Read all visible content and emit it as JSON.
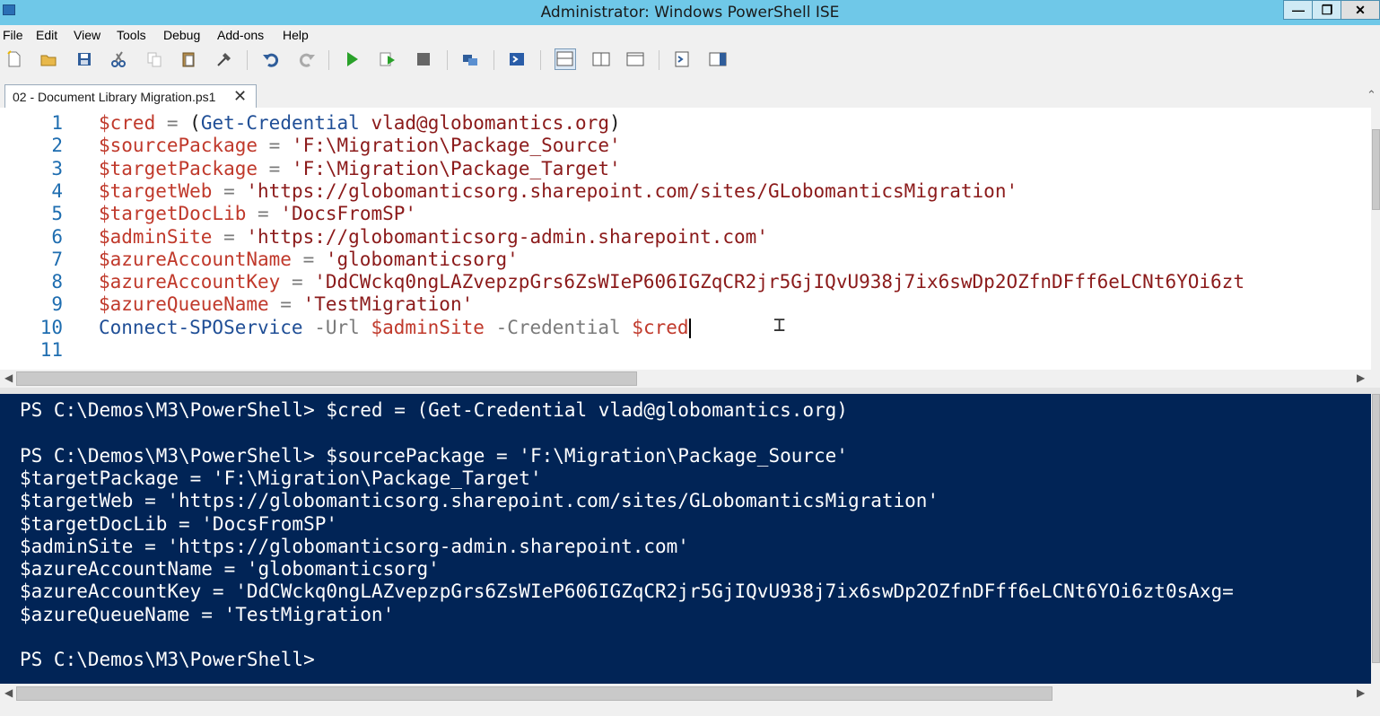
{
  "window": {
    "title": "Administrator: Windows PowerShell ISE",
    "minimize": "—",
    "restore": "❐",
    "close": "✕"
  },
  "menu": [
    "File",
    "Edit",
    "View",
    "Tools",
    "Debug",
    "Add-ons",
    "Help"
  ],
  "toolbar": [
    "new-icon",
    "open-icon",
    "save-icon",
    "cut-icon",
    "copy-icon",
    "paste-icon",
    "clear-icon",
    "undo-icon",
    "redo-icon",
    "run-icon",
    "run-selection-icon",
    "stop-icon",
    "remote-powershell-icon",
    "start-powershell-icon",
    "show-script-top-icon",
    "show-script-right-icon",
    "show-script-max-icon",
    "show-commands-icon",
    "show-command-addon-icon"
  ],
  "tab": {
    "label": "02 - Document Library Migration.ps1",
    "close": "✕"
  },
  "editor": {
    "line_numbers": [
      "1",
      "2",
      "3",
      "4",
      "5",
      "6",
      "7",
      "8",
      "9",
      "10",
      "11"
    ],
    "lines": [
      [
        [
          "v",
          "$cred"
        ],
        [
          "o",
          " = "
        ],
        [
          "p",
          "("
        ],
        [
          "c",
          "Get-Credential"
        ],
        [
          "p",
          " "
        ],
        [
          "s",
          "vlad@globomantics.org"
        ],
        [
          "p",
          ")"
        ]
      ],
      [
        [
          "v",
          "$sourcePackage"
        ],
        [
          "o",
          " = "
        ],
        [
          "s",
          "'F:\\Migration\\Package_Source'"
        ]
      ],
      [
        [
          "v",
          "$targetPackage"
        ],
        [
          "o",
          " = "
        ],
        [
          "s",
          "'F:\\Migration\\Package_Target'"
        ]
      ],
      [
        [
          "v",
          "$targetWeb"
        ],
        [
          "o",
          " = "
        ],
        [
          "s",
          "'https://globomanticsorg.sharepoint.com/sites/GLobomanticsMigration'"
        ]
      ],
      [
        [
          "v",
          "$targetDocLib"
        ],
        [
          "o",
          " = "
        ],
        [
          "s",
          "'DocsFromSP'"
        ]
      ],
      [
        [
          "v",
          "$adminSite"
        ],
        [
          "o",
          " = "
        ],
        [
          "s",
          "'https://globomanticsorg-admin.sharepoint.com'"
        ]
      ],
      [
        [
          "v",
          "$azureAccountName"
        ],
        [
          "o",
          " = "
        ],
        [
          "s",
          "'globomanticsorg'"
        ]
      ],
      [
        [
          "v",
          "$azureAccountKey"
        ],
        [
          "o",
          " = "
        ],
        [
          "s",
          "'DdCWckq0ngLAZvepzpGrs6ZsWIeP606IGZqCR2jr5GjIQvU938j7ix6swDp2OZfnDFff6eLCNt6YOi6zt"
        ]
      ],
      [
        [
          "v",
          "$azureQueueName"
        ],
        [
          "o",
          " = "
        ],
        [
          "s",
          "'TestMigration'"
        ]
      ],
      [
        [
          "c",
          "Connect-SPOService"
        ],
        [
          "p",
          " "
        ],
        [
          "o",
          "-Url"
        ],
        [
          "p",
          " "
        ],
        [
          "v",
          "$adminSite"
        ],
        [
          "p",
          " "
        ],
        [
          "o",
          "-Credential"
        ],
        [
          "p",
          " "
        ],
        [
          "v",
          "$cred"
        ]
      ],
      []
    ]
  },
  "console": {
    "lines": [
      "PS C:\\Demos\\M3\\PowerShell> $cred = (Get-Credential vlad@globomantics.org)",
      "",
      "PS C:\\Demos\\M3\\PowerShell> $sourcePackage = 'F:\\Migration\\Package_Source'",
      "$targetPackage = 'F:\\Migration\\Package_Target'",
      "$targetWeb = 'https://globomanticsorg.sharepoint.com/sites/GLobomanticsMigration'",
      "$targetDocLib = 'DocsFromSP'",
      "$adminSite = 'https://globomanticsorg-admin.sharepoint.com'",
      "$azureAccountName = 'globomanticsorg'",
      "$azureAccountKey = 'DdCWckq0ngLAZvepzpGrs6ZsWIeP606IGZqCR2jr5GjIQvU938j7ix6swDp2OZfnDFff6eLCNt6YOi6zt0sAxg=",
      "$azureQueueName = 'TestMigration'",
      "",
      "PS C:\\Demos\\M3\\PowerShell> "
    ]
  },
  "colors": {
    "titlebar": "#6fc8e8",
    "console_bg": "#012456",
    "variable": "#c0392b",
    "string": "#8b1a1a",
    "command": "#1f4e96",
    "line_number": "#1e6db0"
  }
}
